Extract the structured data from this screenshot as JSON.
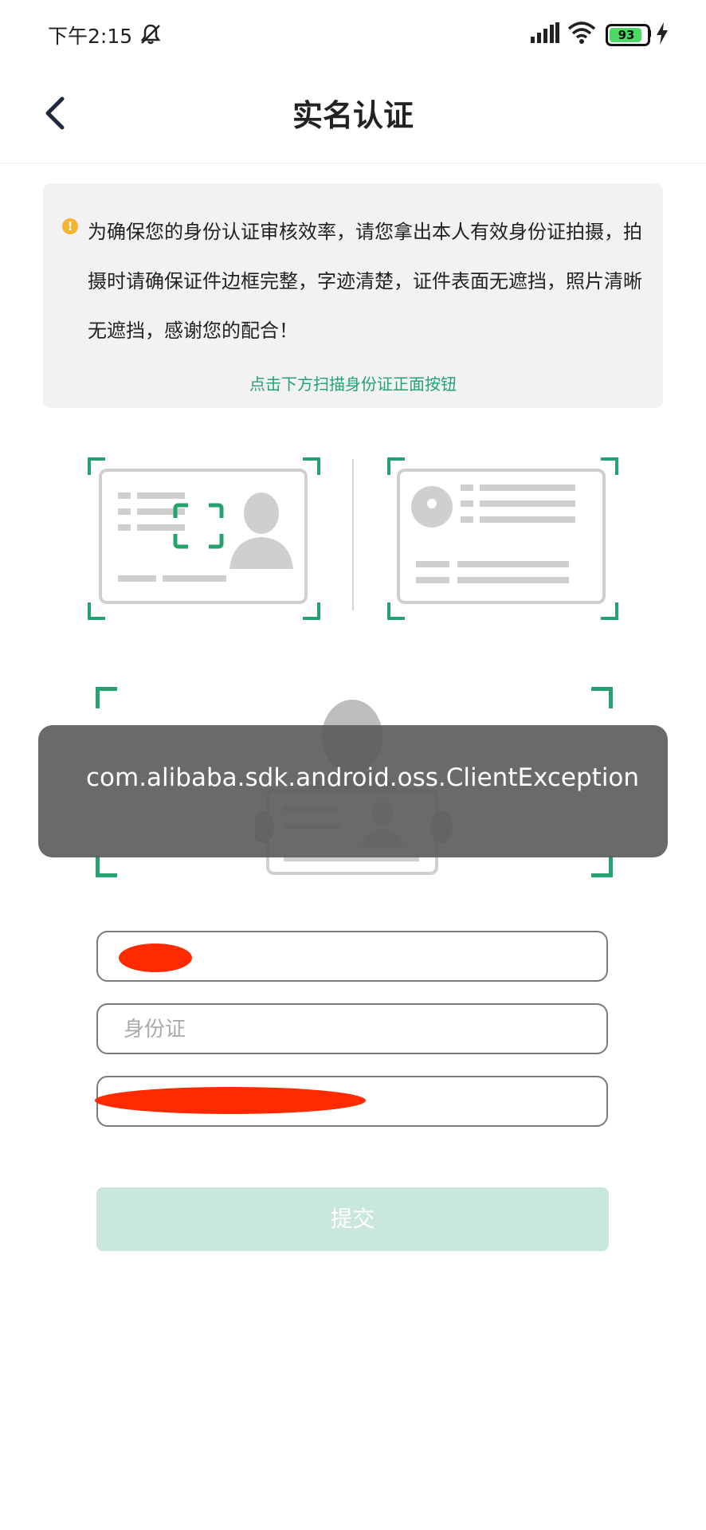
{
  "status_bar": {
    "time": "下午2:15",
    "battery_level": "93",
    "icons": [
      "bell-off-icon",
      "signal-icon",
      "wifi-icon",
      "battery-icon",
      "charging-icon"
    ]
  },
  "header": {
    "title": "实名认证",
    "back_icon": "chevron-left-icon"
  },
  "notice": {
    "icon": "info-icon",
    "text": "为确保您的身份认证审核效率，请您拿出本人有效身份证拍摄，拍摄时请确保证件边框完整，字迹清楚，证件表面无遮挡，照片清晰无遮挡，感谢您的配合！",
    "hint": "点击下方扫描身份证正面按钮"
  },
  "scanners": {
    "front": "id-card-front-icon",
    "back": "id-card-back-icon",
    "face": "face-with-id-icon"
  },
  "toast": {
    "message": "com.alibaba.sdk.android.oss.ClientException"
  },
  "form": {
    "name_value": "",
    "id_placeholder": "身份证",
    "phone_value": ""
  },
  "submit": {
    "label": "提交"
  },
  "colors": {
    "accent": "#25a26f",
    "submit_disabled": "#c9e6df",
    "toast_bg": "#5a5a5c",
    "notice_bg": "#f2f2f4"
  }
}
